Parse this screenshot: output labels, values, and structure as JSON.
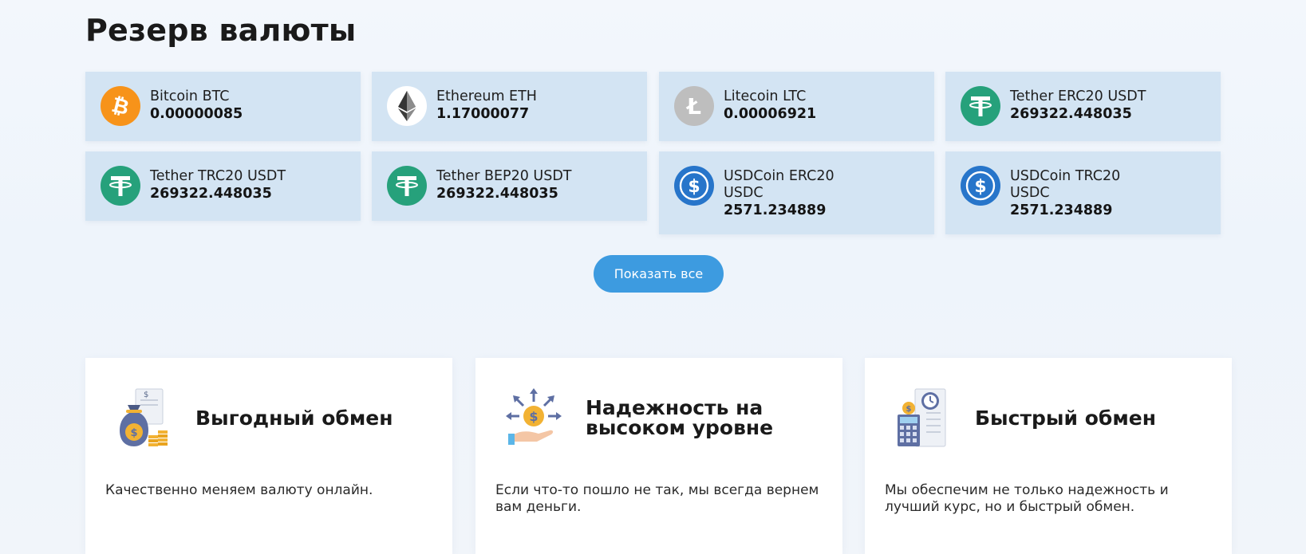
{
  "section": {
    "title": "Резерв валюты"
  },
  "reserves": [
    {
      "name": "Bitcoin BTC",
      "amount": "0.00000085",
      "icon": "bitcoin-icon",
      "color": "#f7931a"
    },
    {
      "name": "Ethereum ETH",
      "amount": "1.17000077",
      "icon": "ethereum-icon",
      "color": "#ffffff"
    },
    {
      "name": "Litecoin LTC",
      "amount": "0.00006921",
      "icon": "litecoin-icon",
      "color": "#bebebe"
    },
    {
      "name": "Tether ERC20 USDT",
      "amount": "269322.448035",
      "icon": "tether-icon",
      "color": "#26a17b"
    },
    {
      "name": "Tether TRC20 USDT",
      "amount": "269322.448035",
      "icon": "tether-icon",
      "color": "#26a17b"
    },
    {
      "name": "Tether BEP20 USDT",
      "amount": "269322.448035",
      "icon": "tether-icon",
      "color": "#26a17b"
    },
    {
      "name_line1": "USDCoin ERC20",
      "name_line2": "USDC",
      "amount": "2571.234889",
      "icon": "usdcoin-icon",
      "color": "#2775ca"
    },
    {
      "name_line1": "USDCoin TRC20",
      "name_line2": "USDC",
      "amount": "2571.234889",
      "icon": "usdcoin-icon",
      "color": "#2775ca"
    }
  ],
  "show_all_label": "Показать все",
  "features": [
    {
      "title": "Выгодный обмен",
      "text": "Качественно меняем валюту онлайн.",
      "icon": "money-bag-icon"
    },
    {
      "title_line1": "Надежность на",
      "title_line2": "высоком уровне",
      "text": "Если что-то пошло не так, мы всегда вернем вам деньги.",
      "icon": "hand-coin-icon"
    },
    {
      "title": "Быстрый обмен",
      "text": "Мы обеспечим не только надежность и лучший курс, но и быстрый обмен.",
      "icon": "calculator-clock-icon"
    }
  ],
  "colors": {
    "card_bg": "#d3e4f3",
    "button_bg": "#3d9be0",
    "page_bg": "#f1f6fc"
  }
}
